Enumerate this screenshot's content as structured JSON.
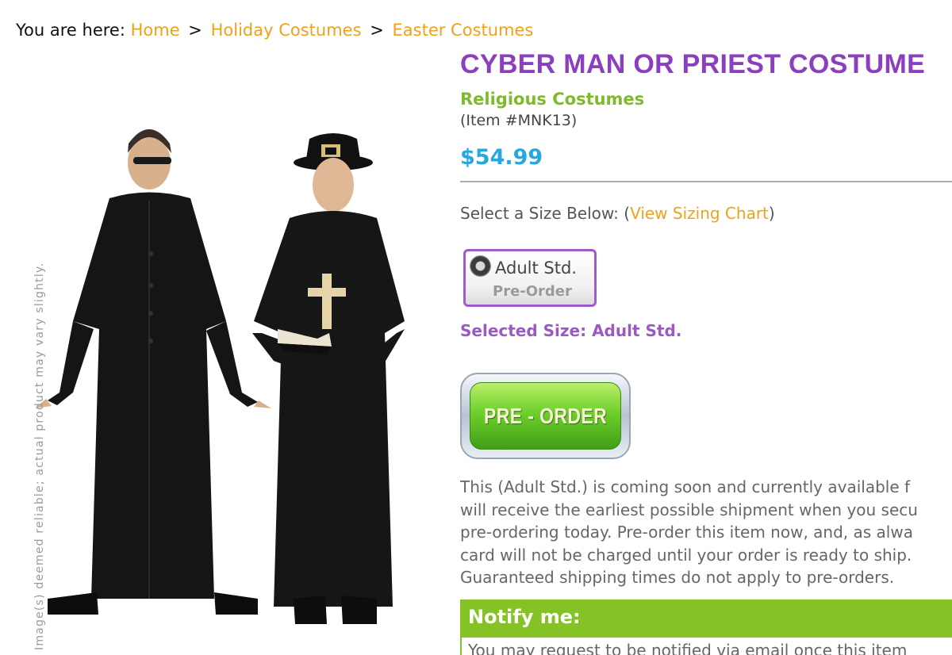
{
  "breadcrumb": {
    "prefix": "You are here:",
    "items": [
      "Home",
      "Holiday Costumes",
      "Easter Costumes"
    ],
    "separator": ">"
  },
  "product_image": {
    "watermark": "Image(s) deemed reliable; actual product may vary slightly."
  },
  "product": {
    "title": "CYBER MAN OR PRIEST COSTUME",
    "category": "Religious Costumes",
    "item_number": "(Item #MNK13)",
    "price": "$54.99"
  },
  "size": {
    "prompt": "Select a Size Below:",
    "chart_open": "(",
    "chart_link": "View Sizing Chart",
    "chart_close": ")",
    "option_label": "Adult Std.",
    "option_status": "Pre-Order",
    "selected_text": "Selected Size: Adult Std."
  },
  "buttons": {
    "preorder": "PRE - ORDER"
  },
  "notice": {
    "lines": [
      "This (Adult Std.) is coming soon and currently available f",
      "will receive the earliest possible shipment when you secu",
      "pre-ordering today. Pre-order this item now, and, as alwa",
      "card will not be charged until your order is ready to ship.",
      "Guaranteed shipping times do not apply to pre-orders."
    ]
  },
  "notify": {
    "heading": "Notify me:",
    "text": "You may request to be notified via email once this item"
  },
  "colors": {
    "title_purple": "#8b3fbf",
    "category_green": "#7dbb2a",
    "price_blue": "#26a7dd",
    "link_orange": "#f0a11b",
    "notify_green": "#84c225"
  }
}
